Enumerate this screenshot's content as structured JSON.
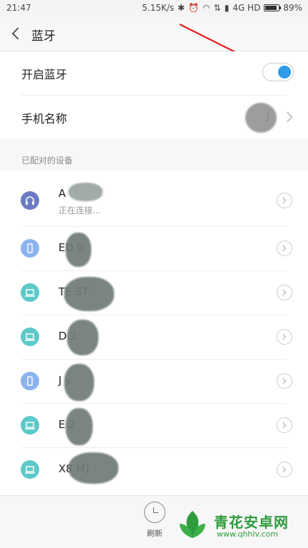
{
  "status_bar": {
    "time": "21:47",
    "speed": "5.15K/s",
    "network": "4G HD",
    "battery": "89%",
    "battery_level": 0.89
  },
  "header": {
    "title": "蓝牙"
  },
  "settings": {
    "bluetooth_label": "开启蓝牙",
    "bluetooth_on": true,
    "phone_name_label": "手机名称",
    "phone_name_value": "J"
  },
  "paired_section": {
    "label": "已配对的设备"
  },
  "devices": [
    {
      "name": "A",
      "status": "正在连接...",
      "icon": "headset-icon"
    },
    {
      "name": "ED 0",
      "status": "",
      "icon": "phone-icon"
    },
    {
      "name": "TE ST",
      "status": "",
      "icon": "laptop-icon"
    },
    {
      "name": "D 2",
      "status": "",
      "icon": "laptop-icon"
    },
    {
      "name": "J y",
      "status": "",
      "icon": "phone-icon"
    },
    {
      "name": "E 2",
      "status": "",
      "icon": "laptop-icon"
    },
    {
      "name": "X8 M)",
      "status": "",
      "icon": "laptop-icon"
    }
  ],
  "bottom": {
    "refresh_label": "刷新"
  },
  "watermark": {
    "text": "青花安卓网",
    "url": "www.qhhlv.com"
  },
  "colors": {
    "accent": "#2f9be8",
    "annotation": "#e02020"
  }
}
